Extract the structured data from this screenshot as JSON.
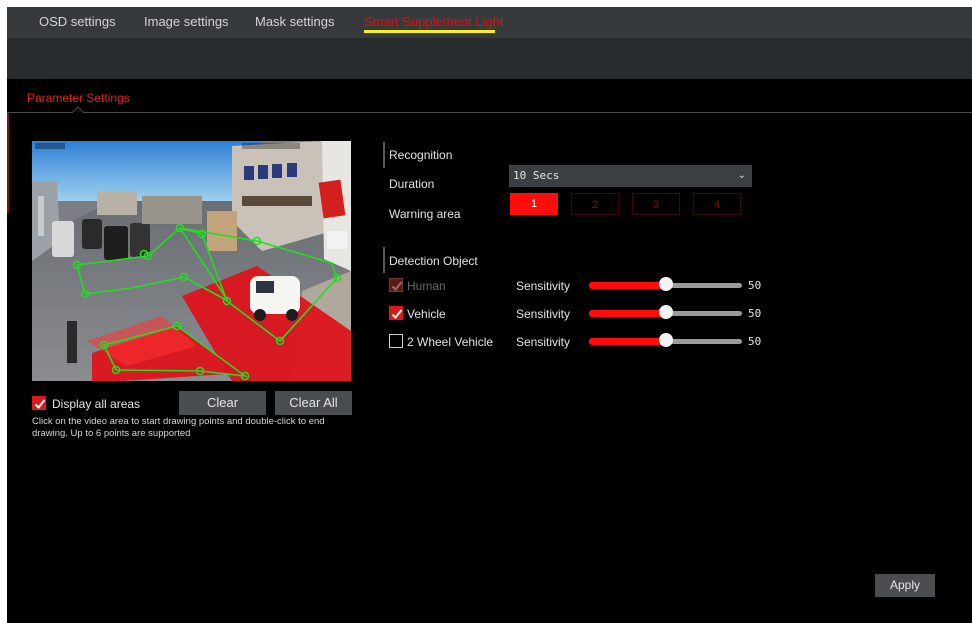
{
  "tabs": [
    {
      "label": "OSD settings",
      "active": false
    },
    {
      "label": "Image settings",
      "active": false
    },
    {
      "label": "Mask settings",
      "active": false
    },
    {
      "label": "Smart Supplement Light",
      "active": true
    }
  ],
  "subtab": {
    "label": "Parameter Settings"
  },
  "video": {
    "osd_date": "2026-01-25 09:12:45",
    "areas": [
      {
        "name": "area-1",
        "color": "#22dd22",
        "fill": "#e0101a"
      },
      {
        "name": "area-2",
        "color": "#22dd22"
      },
      {
        "name": "area-3",
        "color": "#22dd22"
      }
    ]
  },
  "controls": {
    "display_all_label": "Display all areas",
    "display_all_checked": true,
    "clear_label": "Clear",
    "clear_all_label": "Clear All",
    "hint": "Click on the video area to start drawing points and double-click to end drawing. Up to 6 points are supported"
  },
  "recognition": {
    "title": "Recognition",
    "duration_label": "Duration",
    "duration_value": "10 Secs",
    "warning_area_label": "Warning area",
    "areas": [
      {
        "label": "1",
        "active": true
      },
      {
        "label": "2",
        "active": false
      },
      {
        "label": "3",
        "active": false
      },
      {
        "label": "4",
        "active": false
      }
    ]
  },
  "detection": {
    "title": "Detection Object",
    "sensitivity_label": "Sensitivity",
    "objects": [
      {
        "label": "Human",
        "checked": true,
        "disabled": true,
        "sensitivity": 50
      },
      {
        "label": "Vehicle",
        "checked": true,
        "disabled": false,
        "sensitivity": 50
      },
      {
        "label": "2 Wheel Vehicle",
        "checked": false,
        "disabled": false,
        "sensitivity": 50
      }
    ]
  },
  "apply_label": "Apply",
  "colors": {
    "accent": "#ff0d0d",
    "highlight": "#f7f31a",
    "background": "#000000",
    "tabbar": "#363a3c"
  }
}
